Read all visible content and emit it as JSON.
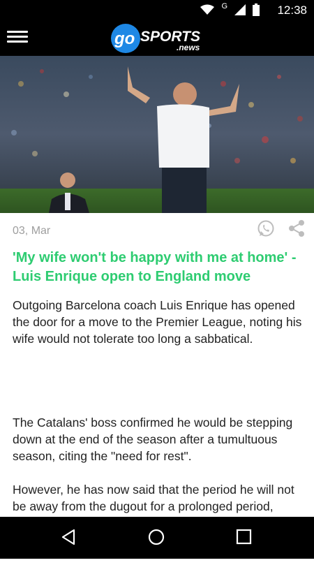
{
  "status_bar": {
    "time": "12:38",
    "network_letter": "G"
  },
  "header": {
    "logo_text": "gosports",
    "logo_sub": ".news"
  },
  "article": {
    "date": "03, Mar",
    "headline": "'My wife won't be happy with me at home' - Luis Enrique open to England move",
    "paragraphs": [
      "Outgoing Barcelona coach Luis Enrique has opened the door for a move to the Premier League, noting his wife would not tolerate too long a sabbatical.",
      "",
      "The Catalans' boss confirmed he would be stepping down at the end of the season after a tumultuous season, citing the \"need for rest\".",
      "However, he has now said that the period he will not be away from the dugout for a prolonged period, joking that his wife would not tolerate at home for too long."
    ]
  },
  "colors": {
    "headline": "#2ecc71",
    "logo_circle": "#1e88e5"
  }
}
